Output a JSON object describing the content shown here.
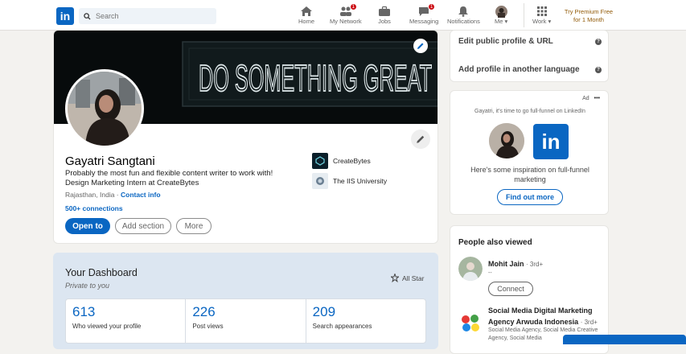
{
  "nav": {
    "search_placeholder": "Search",
    "items": [
      {
        "label": "Home",
        "icon": "home-icon"
      },
      {
        "label": "My Network",
        "icon": "network-icon",
        "badge": "1"
      },
      {
        "label": "Jobs",
        "icon": "briefcase-icon"
      },
      {
        "label": "Messaging",
        "icon": "messaging-icon",
        "badge": "1"
      },
      {
        "label": "Notifications",
        "icon": "bell-icon"
      },
      {
        "label": "Me",
        "icon": "avatar"
      },
      {
        "label": "Work",
        "icon": "grid-icon"
      }
    ],
    "premium_line1": "Try Premium Free",
    "premium_line2": "for 1 Month"
  },
  "profile": {
    "banner_text": "DO SOMETHING GREAT",
    "name": "Gayatri Sangtani",
    "headline": "Probably the most fun and flexible content writer to work with! Design Marketing Intern at CreateBytes",
    "location": "Rajasthan, India ·",
    "contact_info": "Contact info",
    "connections": "500+ connections",
    "btn_open": "Open to",
    "btn_add": "Add section",
    "btn_more": "More",
    "orgs": [
      {
        "name": "CreateBytes"
      },
      {
        "name": "The IIS University"
      }
    ]
  },
  "dashboard": {
    "title": "Your Dashboard",
    "subtitle": "Private to you",
    "all_star": "All Star",
    "stats": [
      {
        "value": "613",
        "label": "Who viewed your profile"
      },
      {
        "value": "226",
        "label": "Post views"
      },
      {
        "value": "209",
        "label": "Search appearances"
      }
    ]
  },
  "right": {
    "edit_url": "Edit public profile & URL",
    "add_lang": "Add profile in another language",
    "ad_label": "Ad",
    "ad_dots": "•••",
    "ad_text": "Gayatri, it's time to go full-funnel on LinkedIn",
    "ad_copy": "Here's some inspiration on full-funnel marketing",
    "ad_button": "Find out more",
    "pav_title": "People also viewed",
    "p1_name": "Mohit Jain",
    "p1_degree": "· 3rd+",
    "p1_sub": "--",
    "connect": "Connect",
    "p2_name": "Social Media Digital Marketing Agency Arwuda Indonesia",
    "p2_degree": "· 3rd+",
    "p2_sub": "Social Media Agency, Social Media Creative Agency, Social Media"
  },
  "colors": {
    "brand": "#0a66c2",
    "badge": "#cc1016",
    "premium": "#915907"
  }
}
